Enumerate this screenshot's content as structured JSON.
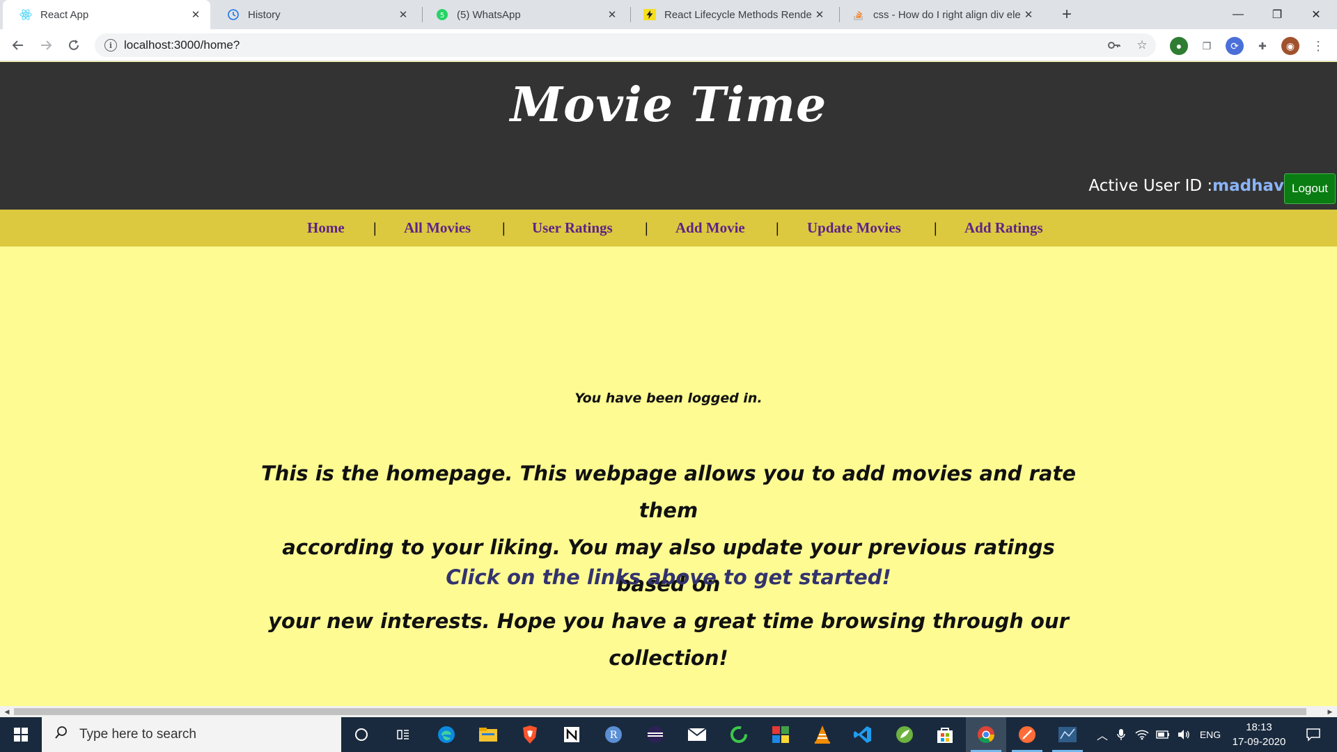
{
  "browser": {
    "tabs": [
      {
        "title": "React App",
        "icon": "react-icon",
        "active": true
      },
      {
        "title": "History",
        "icon": "history-icon",
        "active": false
      },
      {
        "title": "(5) WhatsApp",
        "icon": "whatsapp-icon",
        "active": false
      },
      {
        "title": "React Lifecycle Methods Render /",
        "icon": "bolt-icon",
        "active": false
      },
      {
        "title": "css - How do I right align div eler",
        "icon": "stackoverflow-icon",
        "active": false
      }
    ],
    "url": "localhost:3000/home?"
  },
  "header": {
    "brand": "Movie Time",
    "active_user_label": "Active User ID :",
    "active_user_id": "madhav",
    "logout_label": "Logout"
  },
  "nav": {
    "items": [
      "Home",
      "All Movies",
      "User Ratings",
      "Add Movie",
      "Update Movies",
      "Add Ratings"
    ],
    "separator": "|"
  },
  "main": {
    "login_message": "You have been logged in.",
    "intro_lines": [
      "This is the homepage. This webpage allows you to add movies and rate them",
      "according to your liking. You may also update your previous ratings based on",
      "your new interests. Hope you have a great time browsing through our collection!"
    ],
    "cta": "Click on the links above to get started!"
  },
  "taskbar": {
    "search_placeholder": "Type here to search",
    "language": "ENG",
    "time": "18:13",
    "date": "17-09-2020"
  },
  "colors": {
    "header_bg": "#333333",
    "nav_bg": "#dcc93f",
    "page_bg": "#fdfb92",
    "nav_link": "#5c2486",
    "logout_bg": "#0a7d12",
    "cta": "#33336e"
  }
}
